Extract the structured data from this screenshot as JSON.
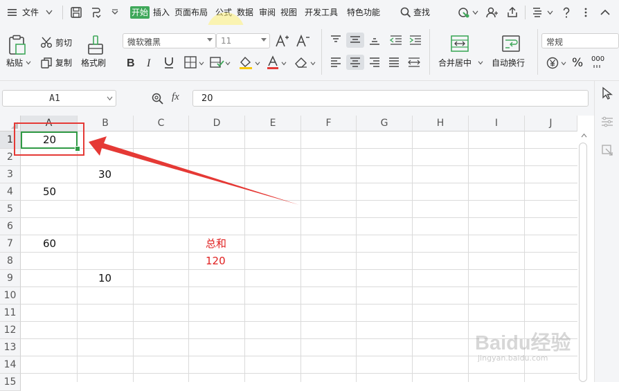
{
  "menubar": {
    "file": "文件",
    "tabs": [
      {
        "label": "开始",
        "active": true
      },
      {
        "label": "插入",
        "active": false
      },
      {
        "label": "页面布局",
        "active": false
      },
      {
        "label": "公式",
        "active": false
      },
      {
        "label": "数据",
        "active": false
      },
      {
        "label": "审阅",
        "active": false
      },
      {
        "label": "视图",
        "active": false
      },
      {
        "label": "开发工具",
        "active": false
      },
      {
        "label": "特色功能",
        "active": false
      }
    ],
    "search": "查找"
  },
  "ribbon": {
    "paste": "粘贴",
    "cut": "剪切",
    "copy": "复制",
    "format_painter": "格式刷",
    "font_name": "微软雅黑",
    "font_size": "11",
    "merge_center": "合并居中",
    "wrap_text": "自动换行",
    "number_format": "常规",
    "percent": "%",
    "decimals": "000"
  },
  "formula_bar": {
    "name_box": "A1",
    "fx": "fx",
    "value": "20"
  },
  "sheet": {
    "columns": [
      "A",
      "B",
      "C",
      "D",
      "E",
      "F",
      "G",
      "H",
      "I",
      "J"
    ],
    "rows": [
      "1",
      "2",
      "3",
      "4",
      "5",
      "6",
      "7",
      "8",
      "9",
      "10",
      "11",
      "12",
      "13",
      "14",
      "15"
    ],
    "cells": {
      "A1": "20",
      "B3": "30",
      "A4": "50",
      "A7": "60",
      "D7": "总和",
      "D8": "120",
      "B9": "10"
    }
  },
  "colors": {
    "active_tab": "#3fa85a",
    "selection": "#2f9a45",
    "annotation": "#e53935",
    "sum_text": "#e02020"
  },
  "watermark": {
    "line1": "Baidu经验",
    "line2": "jingyan.baidu.com"
  }
}
